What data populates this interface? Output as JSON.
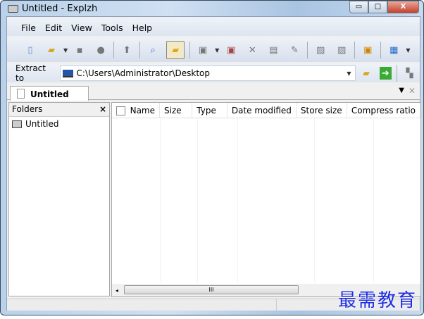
{
  "window": {
    "title": "Untitled - Explzh",
    "minimize": "▭",
    "maximize": "□",
    "close": "X"
  },
  "menu": [
    "File",
    "Edit",
    "View",
    "Tools",
    "Help"
  ],
  "toolbar": {
    "icons": [
      "new-archive-icon",
      "open-icon",
      "save-icon",
      "test-icon",
      "up-icon",
      "view-icon",
      "folder-icon",
      "add-icon",
      "new-icon",
      "delete-icon",
      "properties-icon",
      "settings-icon",
      "extract-icon",
      "convert-icon",
      "sfx-icon",
      "view-mode-icon"
    ]
  },
  "extract": {
    "label": "Extract to",
    "path": "C:\\Users\\Administrator\\Desktop"
  },
  "tab": {
    "label": "Untitled"
  },
  "folders": {
    "title": "Folders",
    "close": "×",
    "items": [
      "Untitled"
    ]
  },
  "columns": [
    "Name",
    "Size",
    "Type",
    "Date modified",
    "Store size",
    "Compress ratio"
  ],
  "watermark": "最需教育"
}
